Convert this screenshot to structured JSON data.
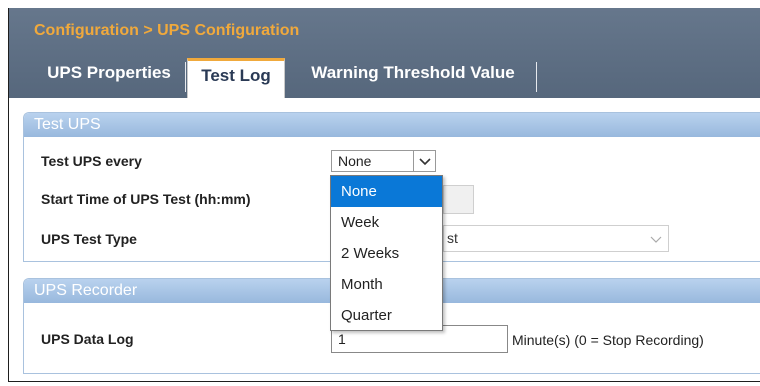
{
  "breadcrumb": "Configuration > UPS Configuration",
  "tabs": [
    {
      "label": "UPS Properties"
    },
    {
      "label": "Test Log"
    },
    {
      "label": "Warning Threshold Value"
    }
  ],
  "test_ups": {
    "title": "Test UPS",
    "every_label": "Test UPS every",
    "every_value": "None",
    "start_time_label": "Start Time of UPS Test (hh:mm)",
    "test_type_label": "UPS Test Type",
    "test_type_value_partial": "st",
    "dropdown_options": [
      "None",
      "Week",
      "2 Weeks",
      "Month",
      "Quarter"
    ]
  },
  "recorder": {
    "title": "UPS Recorder",
    "data_log_label": "UPS Data Log",
    "data_log_value": "1",
    "data_log_hint": "Minute(s) (0 = Stop Recording)"
  },
  "colors": {
    "header_bg": "#5e6f84",
    "accent_orange": "#f0a93c",
    "section_header": "#a8c5e6",
    "selected_option": "#0a78d7"
  }
}
